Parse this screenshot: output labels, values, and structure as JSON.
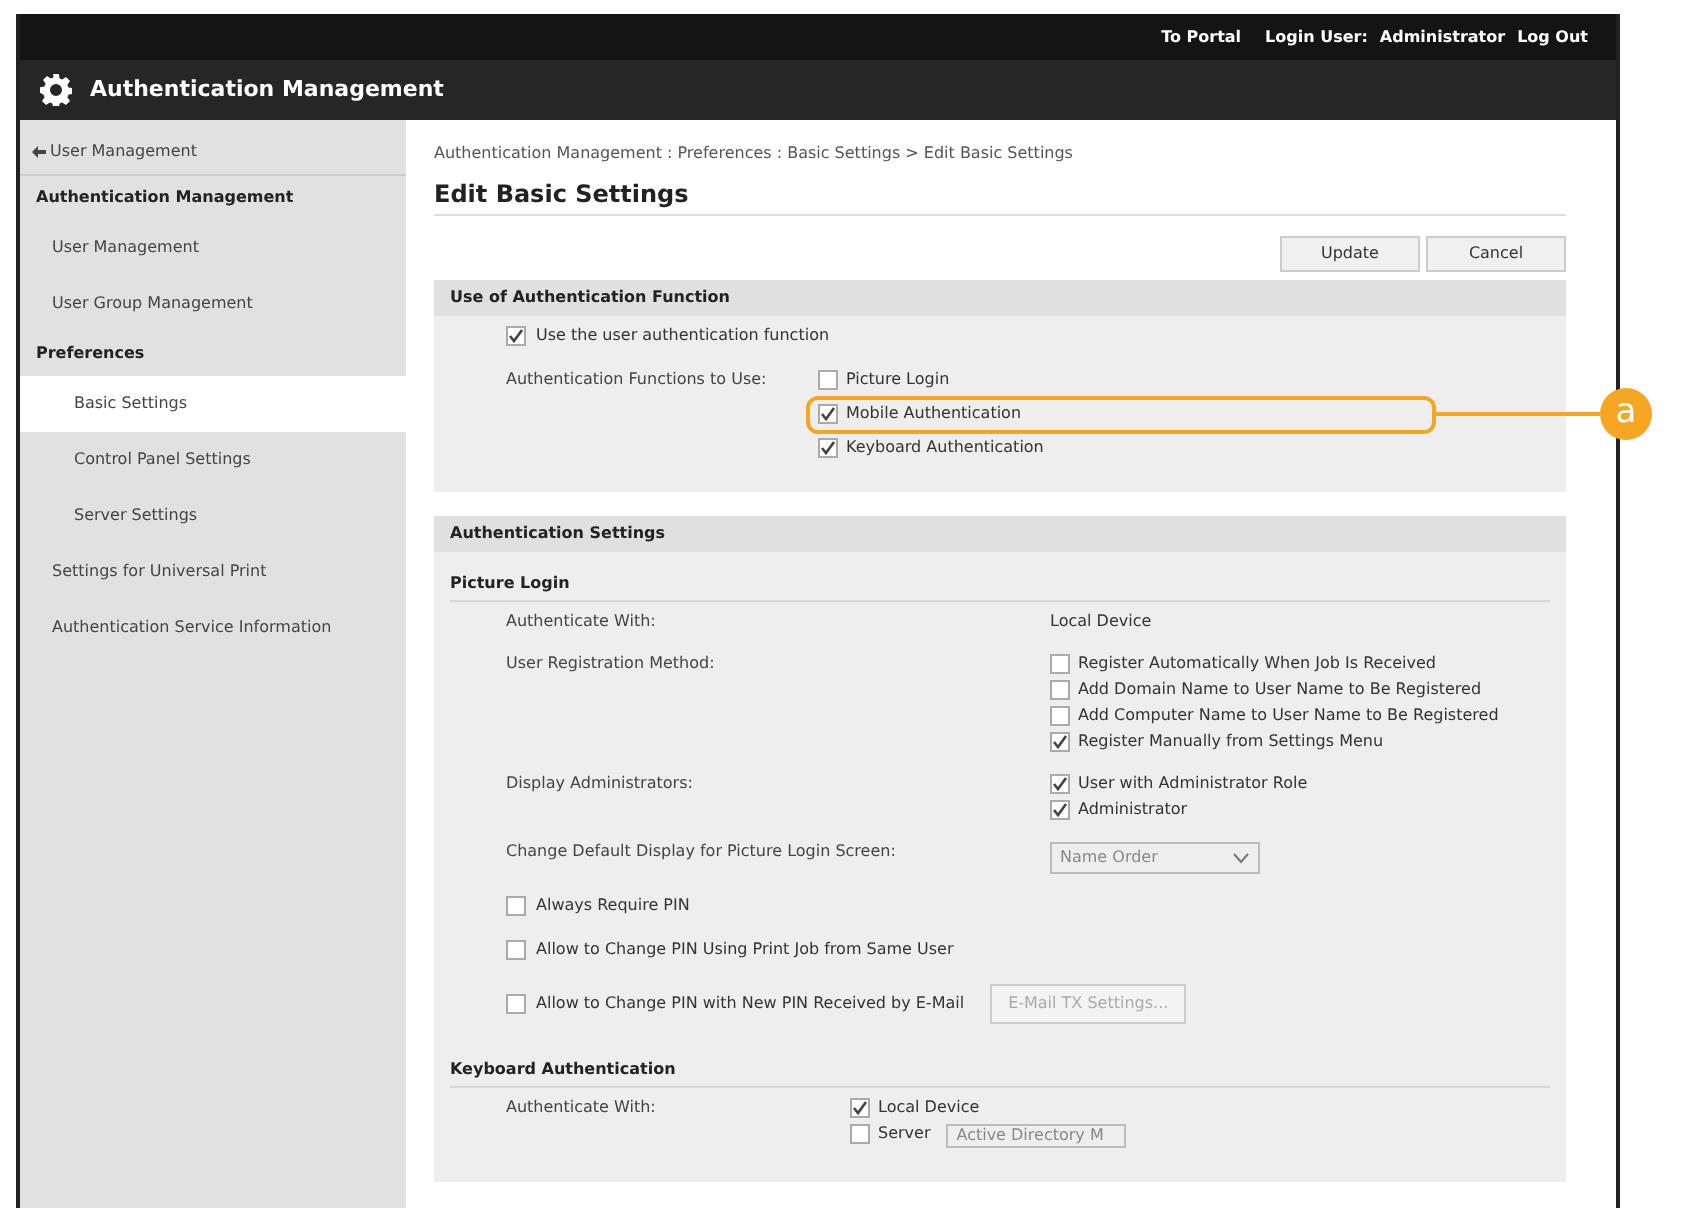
{
  "top_bar": {
    "portal_link": "To Portal",
    "login_label": "Login User:",
    "login_user": "Administrator",
    "logout_link": "Log Out"
  },
  "title_bar": {
    "title": "Authentication Management"
  },
  "sidebar": {
    "items": [
      {
        "kind": "back",
        "label": "User Management",
        "selected": false
      },
      {
        "kind": "heading",
        "label": "Authentication Management",
        "selected": false
      },
      {
        "kind": "link",
        "label": "User Management",
        "selected": false
      },
      {
        "kind": "link",
        "label": "User Group Management",
        "selected": false
      },
      {
        "kind": "heading",
        "label": "Preferences",
        "selected": false
      },
      {
        "kind": "sublink",
        "label": "Basic Settings",
        "selected": true
      },
      {
        "kind": "sublink",
        "label": "Control Panel Settings",
        "selected": false
      },
      {
        "kind": "sublink",
        "label": "Server Settings",
        "selected": false
      },
      {
        "kind": "link",
        "label": "Settings for Universal Print",
        "selected": false
      },
      {
        "kind": "link",
        "label": "Authentication Service Information",
        "selected": false
      }
    ]
  },
  "breadcrumb": "Authentication Management : Preferences : Basic Settings > Edit Basic Settings",
  "page_title": "Edit Basic Settings",
  "buttons": [
    "Update",
    "Cancel"
  ],
  "sections": [
    {
      "title": "Use of Authentication Function",
      "groups": [
        {
          "rows": [
            {
              "kind": "checkbox",
              "label": "Use the user authentication function",
              "checked": true
            },
            {
              "kind": "options",
              "label": "Authentication Functions to Use:",
              "options": [
                {
                  "label": "Picture Login",
                  "checked": false
                },
                {
                  "label": "Mobile Authentication",
                  "checked": true,
                  "callout": "a"
                },
                {
                  "label": "Keyboard Authentication",
                  "checked": true
                }
              ]
            }
          ]
        }
      ]
    },
    {
      "title": "Authentication Settings",
      "groups": [
        {
          "title": "Picture Login",
          "rows": [
            {
              "kind": "text",
              "label": "Authenticate With:",
              "value": "Local Device"
            },
            {
              "kind": "options",
              "label": "User Registration Method:",
              "options": [
                {
                  "label": "Register Automatically When Job Is Received",
                  "checked": false
                },
                {
                  "label": "Add Domain Name to User Name to Be Registered",
                  "checked": false
                },
                {
                  "label": "Add Computer Name to User Name to Be Registered",
                  "checked": false
                },
                {
                  "label": "Register Manually from Settings Menu",
                  "checked": true
                }
              ]
            },
            {
              "kind": "options",
              "label": "Display Administrators:",
              "options": [
                {
                  "label": "User with Administrator Role",
                  "checked": true
                },
                {
                  "label": "Administrator",
                  "checked": true
                }
              ]
            },
            {
              "kind": "select",
              "label": "Change Default Display for Picture Login Screen:",
              "value": "Name Order"
            },
            {
              "kind": "checkbox",
              "label": "Always Require PIN",
              "checked": false
            },
            {
              "kind": "checkbox",
              "label": "Allow to Change PIN Using Print Job from Same User",
              "checked": false
            },
            {
              "kind": "checkbox",
              "label": "Allow to Change PIN with New PIN Received by E-Mail",
              "checked": false,
              "button": "E-Mail TX Settings..."
            }
          ]
        },
        {
          "title": "Keyboard Authentication",
          "rows": [
            {
              "kind": "options",
              "label": "Authenticate With:",
              "options": [
                {
                  "label": "Local Device",
                  "checked": true
                },
                {
                  "label": "Server",
                  "checked": false,
                  "select": "Active Directory M"
                }
              ]
            }
          ]
        }
      ]
    }
  ]
}
